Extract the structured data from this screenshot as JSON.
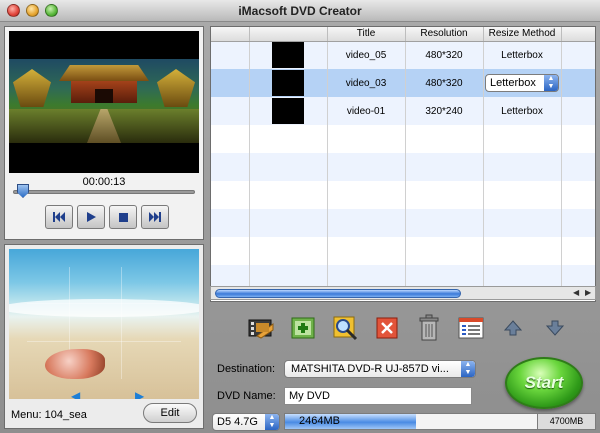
{
  "window": {
    "title": "iMacsoft DVD Creator"
  },
  "preview": {
    "timecode": "00:00:13",
    "progress": 0.05
  },
  "menu_panel": {
    "label": "Menu: 104_sea",
    "edit_label": "Edit"
  },
  "table": {
    "columns": [
      "",
      "",
      "Title",
      "Resolution",
      "Resize Method"
    ],
    "rows": [
      {
        "title": "video_05",
        "resolution": "480*320",
        "resize": "Letterbox",
        "selected": false
      },
      {
        "title": "video_03",
        "resolution": "480*320",
        "resize": "Letterbox",
        "selected": true
      },
      {
        "title": "video-01",
        "resolution": "320*240",
        "resize": "Letterbox",
        "selected": false
      }
    ]
  },
  "form": {
    "destination_label": "Destination:",
    "destination_value": "MATSHITA DVD-R   UJ-857D vi...",
    "dvd_name_label": "DVD Name:",
    "dvd_name_value": "My DVD",
    "start_label": "Start",
    "disc_type": "D5 4.7G",
    "used": "2464MB",
    "total": "4700MB",
    "used_fraction": 0.52
  },
  "colors": {
    "accent": "#3b7ad9",
    "start_green": "#2e9918",
    "selected_row": "#b5d2f5"
  }
}
